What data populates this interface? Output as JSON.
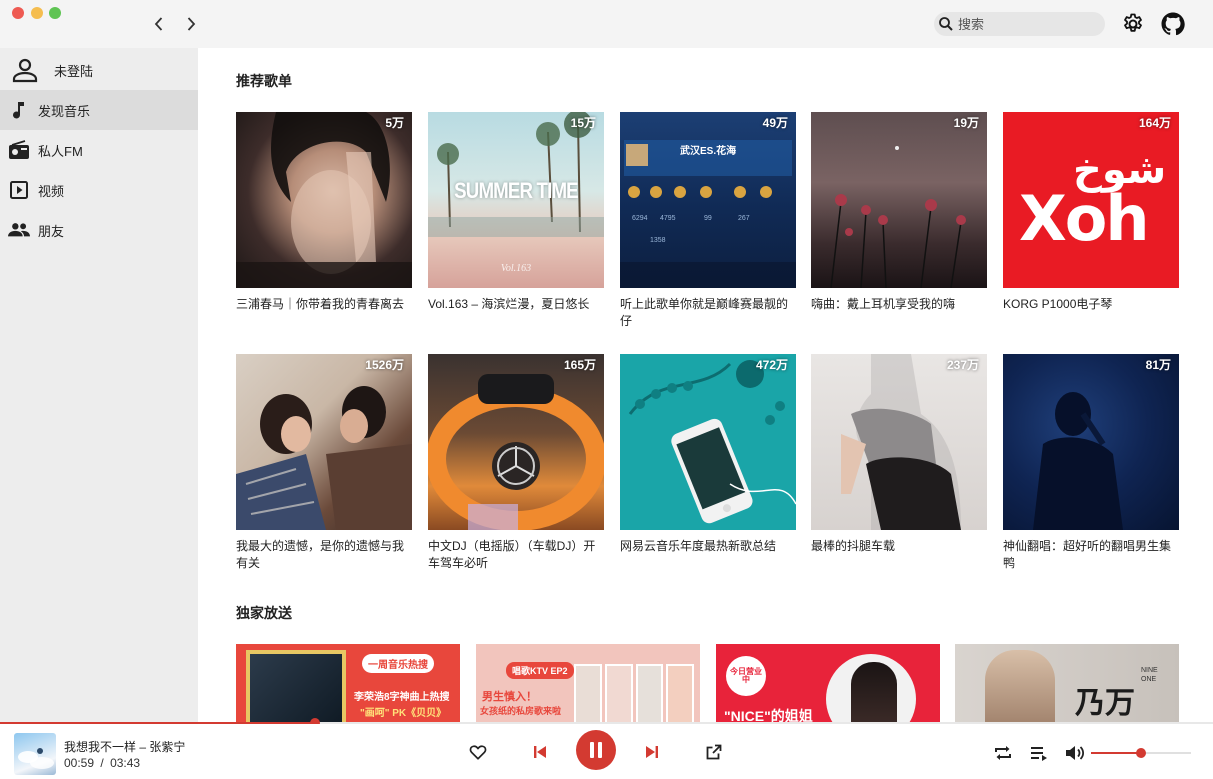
{
  "window": {
    "traffic_colors": [
      "#ee5a52",
      "#f5bd4f",
      "#5fc453"
    ]
  },
  "nav": {
    "back": "‹",
    "forward": "›"
  },
  "search": {
    "placeholder": "搜索"
  },
  "sidebar": {
    "user": {
      "label": "未登陆"
    },
    "items": [
      {
        "label": "发现音乐",
        "icon": "music-note-icon",
        "active": true
      },
      {
        "label": "私人FM",
        "icon": "radio-icon",
        "active": false
      },
      {
        "label": "视频",
        "icon": "video-icon",
        "active": false
      },
      {
        "label": "朋友",
        "icon": "friends-icon",
        "active": false
      }
    ]
  },
  "main": {
    "recommend_title": "推荐歌单",
    "exclusive_title": "独家放送",
    "playlists": [
      {
        "title": "三浦春马｜你带着我的青春离去",
        "plays": "5万"
      },
      {
        "title": "Vol.163 – 海滨烂漫，夏日悠长",
        "plays": "15万",
        "cover_text": "SUMMER TIME",
        "cover_sub": "Vol.163"
      },
      {
        "title": "听上此歌单你就是巅峰赛最靓的仔",
        "plays": "49万",
        "cover_text": "武汉ES.花海"
      },
      {
        "title": "嗨曲：戴上耳机享受我的嗨",
        "plays": "19万"
      },
      {
        "title": "KORG P1000电子琴",
        "plays": "164万",
        "cover_text": "Xoh",
        "cover_sub": "شوخ"
      },
      {
        "title": "我最大的遗憾，是你的遗憾与我有关",
        "plays": "1526万"
      },
      {
        "title": "中文DJ（电摇版）（车载DJ）开车驾车必听",
        "plays": "165万"
      },
      {
        "title": "网易云音乐年度最热新歌总结",
        "plays": "472万"
      },
      {
        "title": "最棒的抖腿车载",
        "plays": "237万"
      },
      {
        "title": "神仙翻唱：超好听的翻唱男生集鸭",
        "plays": "81万"
      }
    ],
    "banners": [
      {
        "text": "李荣浩8字神曲上热搜",
        "sub": "\"画呵\" PK《贝贝》",
        "logo": "一周音乐热搜"
      },
      {
        "text": "男生慎入！",
        "sub": "女孩纸的私房歌来啦",
        "logo": "唱歌KTV EP2"
      },
      {
        "text": "\"NICE\"的姐姐",
        "logo": "今日营业中"
      },
      {
        "text": "乃万",
        "sub": "NINE ONE"
      }
    ]
  },
  "player": {
    "song": "我想我不一样 – 张紫宁",
    "current_time": "00:59",
    "separator": "/",
    "total_time": "03:43",
    "progress": 0.26,
    "volume": 0.5,
    "accent": "#d33a31"
  }
}
